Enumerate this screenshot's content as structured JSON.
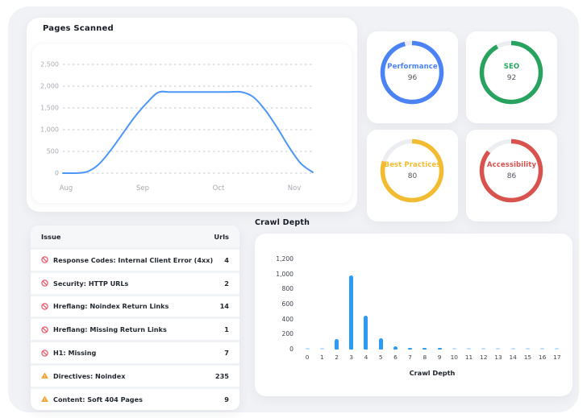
{
  "page": {
    "background": "#ffffff",
    "canvas_background": "#F1F2F6"
  },
  "pages_scanned": {
    "title": "Pages Scanned"
  },
  "gauges": [
    {
      "label": "Performance",
      "value": 96,
      "color": "#4B82F4",
      "track_color": "#ECEDF1"
    },
    {
      "label": "SEO",
      "value": 92,
      "color": "#27A35F",
      "track_color": "#ECEDF1"
    },
    {
      "label": "Best Practices",
      "value": 80,
      "color": "#F3BB2F",
      "track_color": "#ECEDF1"
    },
    {
      "label": "Accessibility",
      "value": 86,
      "color": "#D8534E",
      "track_color": "#ECEDF1"
    }
  ],
  "issues_table": {
    "headers": [
      "Issue",
      "Urls"
    ],
    "rows": [
      {
        "icon": "error",
        "label": "Response Codes: Internal Client Error (4xx)",
        "urls": "4"
      },
      {
        "icon": "error",
        "label": "Security: HTTP URLs",
        "urls": "2"
      },
      {
        "icon": "error",
        "label": "Hreflang: Noindex Return Links",
        "urls": "14"
      },
      {
        "icon": "error",
        "label": "Hreflang: Missing Return Links",
        "urls": "1"
      },
      {
        "icon": "error",
        "label": "H1: Missing",
        "urls": "7"
      },
      {
        "icon": "warning",
        "label": "Directives: Noindex",
        "urls": "235"
      },
      {
        "icon": "warning",
        "label": "Content: Soft 404 Pages",
        "urls": "9"
      }
    ],
    "icon_colors": {
      "error": "#E8596B",
      "warning": "#F3A73B"
    }
  },
  "crawl_depth": {
    "title": "Crawl Depth",
    "xlabel": "Crawl Depth"
  },
  "chart_data": [
    {
      "type": "line",
      "title": "Pages Scanned",
      "x_ticks": [
        "Aug",
        "Sep",
        "Oct",
        "Nov"
      ],
      "y_ticks": [
        "0",
        "500",
        "1,000",
        "1,500",
        "2,000",
        "2,500"
      ],
      "ylim": [
        0,
        2500
      ],
      "grid": "dashed-horizontal",
      "legend": "none",
      "line_color": "#4E96F7",
      "series": [
        {
          "name": "Pages Scanned",
          "note": "points evenly spaced from start of Aug to mid-Nov; plateau ~1865 mid-Sep to mid-Oct",
          "values": [
            0,
            0,
            30,
            200,
            520,
            900,
            1280,
            1600,
            1855,
            1865,
            1865,
            1865,
            1865,
            1865,
            1865,
            1865,
            1750,
            1450,
            1050,
            600,
            220,
            20
          ]
        }
      ]
    },
    {
      "type": "bar",
      "title": "Crawl Depth",
      "categories": [
        "0",
        "1",
        "2",
        "3",
        "4",
        "5",
        "6",
        "7",
        "8",
        "9",
        "10",
        "11",
        "12",
        "13",
        "14",
        "15",
        "16",
        "17"
      ],
      "values": [
        2,
        3,
        140,
        990,
        450,
        150,
        40,
        25,
        15,
        10,
        3,
        3,
        3,
        3,
        3,
        3,
        3,
        3
      ],
      "xlabel": "Crawl Depth",
      "ylabel": "",
      "y_ticks": [
        "0",
        "200",
        "400",
        "600",
        "800",
        "1,000",
        "1,200"
      ],
      "ylim": [
        0,
        1200
      ],
      "grid": "off",
      "bar_color": "#2C9BF4",
      "muted_bar_color": "#BFDFFA"
    }
  ]
}
